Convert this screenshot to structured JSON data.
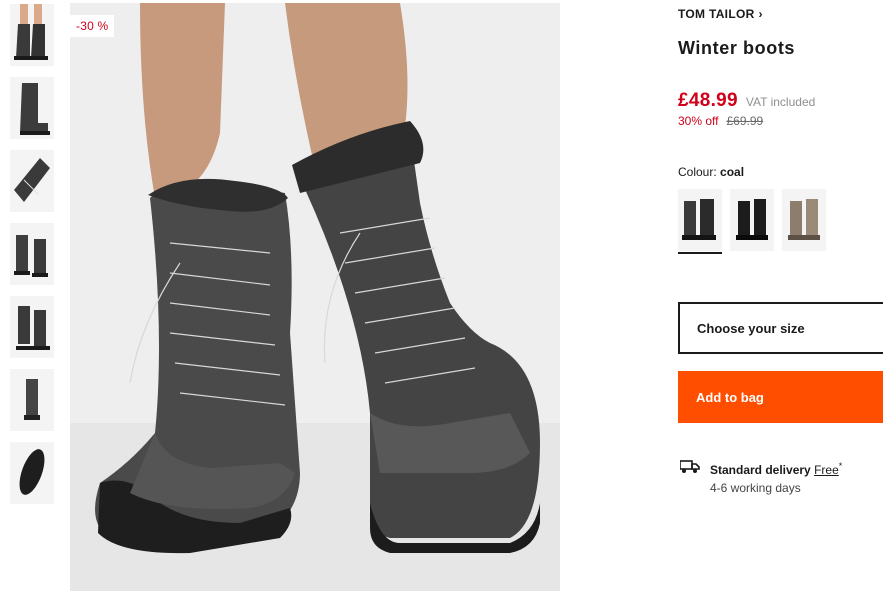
{
  "product": {
    "discount_badge": "-30 %",
    "brand": "TOM TAILOR",
    "brand_chevron": "›",
    "title": "Winter boots",
    "price": "£48.99",
    "vat_note": "VAT included",
    "percent_off": "30% off",
    "original_price": "£69.99",
    "colour_label": "Colour:",
    "colour_value": "coal"
  },
  "gallery": {
    "thumbnail_count": 7,
    "active_index": 0,
    "swatch_count": 3,
    "selected_swatch": 0,
    "swatch_colors": [
      "#2b2b2b",
      "#1c1c1c",
      "#8c7d6d"
    ]
  },
  "actions": {
    "size_label": "Choose your size",
    "add_to_bag": "Add to bag"
  },
  "delivery": {
    "title": "Standard delivery",
    "price": "Free",
    "asterisk": "*",
    "time": "4-6 working days",
    "icon": "truck-icon"
  },
  "colors": {
    "sale_red": "#d0021b",
    "accent_orange": "#ff4e00",
    "text": "#1a1a1a"
  }
}
